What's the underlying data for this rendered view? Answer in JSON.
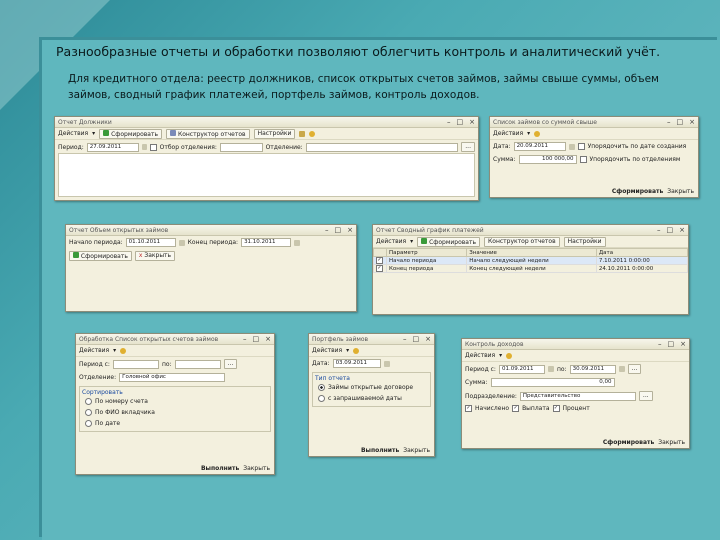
{
  "slide": {
    "title": "Разнообразные отчеты и обработки позволяют облегчить контроль и аналитический учёт.",
    "subtitle": "Для кредитного отдела: реестр должников, список открытых счетов займов, займы свыше суммы, объем займов, сводный график платежей, портфель займов, контроль доходов."
  },
  "common": {
    "actions": "Действия",
    "close": "Закрыть",
    "generate": "Сформировать",
    "settings": "Настройки",
    "run": "Выполнить",
    "dots": "...",
    "x": "x"
  },
  "w1": {
    "title": "Отчет Должники",
    "generate": "Сформировать",
    "designer": "Конструктор отчетов",
    "settings": "Настройки",
    "period_label": "Период:",
    "period": "27.09.2011",
    "select_branches": "Отбор отделения:",
    "branch_label": "Отделение:"
  },
  "w2": {
    "title": "Список займов со суммой свыше",
    "date_label": "Дата:",
    "date": "20.09.2011",
    "sort_label": "Упорядочить по дате создания",
    "sum_label": "Сумма:",
    "sum": "100 000,00",
    "by_branches": "Упорядочить по отделениям",
    "generate": "Сформировать",
    "close": "Закрыть"
  },
  "w3": {
    "title": "Отчет Объем открытых займов",
    "start_label": "Начало периода:",
    "start": "01.10.2011",
    "end_label": "Конец периода:",
    "end": "31.10.2011",
    "generate": "Сформировать",
    "close": "Закрыть"
  },
  "w4": {
    "title": "Отчет Сводный график платежей",
    "generate": "Сформировать",
    "designer": "Конструктор отчетов",
    "settings": "Настройки",
    "headers": [
      "Параметр",
      "Значение",
      "Дата"
    ],
    "rows": [
      {
        "param": "Начало периода",
        "value": "Начало следующей недели",
        "date": "7.10.2011 0:00:00",
        "checked": true
      },
      {
        "param": "Конец периода",
        "value": "Конец следующей недели",
        "date": "24.10.2011 0:00:00",
        "checked": true
      }
    ]
  },
  "w5": {
    "title": "Обработка Список открытых счетов займов",
    "period_label": "Период с:",
    "to_label": "по:",
    "branch_label": "Отделение:",
    "branch": "Головной офис",
    "group": "Сортировать",
    "opt1": "По номеру счета",
    "opt2": "По ФИО вкладчика",
    "opt3": "По дате",
    "run": "Выполнить",
    "close": "Закрыть"
  },
  "w6": {
    "title": "Портфель займов",
    "date_label": "Дата:",
    "date": "03.09.2011",
    "group": "Тип отчета",
    "opt1": "Займы открытые договоре",
    "opt2": "с запрашиваемой даты",
    "run": "Выполнить",
    "close": "Закрыть"
  },
  "w7": {
    "title": "Контроль доходов",
    "period_label": "Период с:",
    "from": "01.09.2011",
    "to_label": "по:",
    "to": "30.09.2011",
    "sum_label": "Сумма:",
    "sum": "0,00",
    "branch_label": "Подразделение:",
    "branch": "Представительство",
    "cb1": "Начислено",
    "cb2": "Выплата",
    "cb3": "Процент",
    "generate": "Сформировать",
    "close": "Закрыть"
  },
  "colors": {
    "background": "#4aaab3",
    "window": "#f3f0de",
    "link": "#1a4aa0"
  }
}
